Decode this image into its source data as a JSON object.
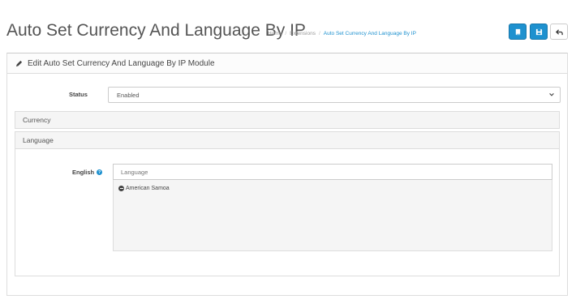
{
  "header": {
    "title": "Auto Set Currency And Language By IP",
    "breadcrumb": [
      "Home",
      "Extensions",
      "Auto Set Currency And Language By IP"
    ]
  },
  "toolbar": {
    "buttons": [
      {
        "icon": "book-icon",
        "style": "primary"
      },
      {
        "icon": "save-icon",
        "style": "primary"
      },
      {
        "icon": "back-icon",
        "style": "default"
      }
    ]
  },
  "panel": {
    "heading": "Edit Auto Set Currency And Language By IP Module",
    "status": {
      "label": "Status",
      "value": "Enabled"
    },
    "sections": [
      "Currency",
      "Language"
    ],
    "language": {
      "label": "English",
      "placeholder": "Language",
      "selected": [
        "American Samoa"
      ]
    }
  },
  "colors": {
    "accent": "#1e91cf",
    "border": "#dddddd",
    "well": "#f5f5f5"
  }
}
